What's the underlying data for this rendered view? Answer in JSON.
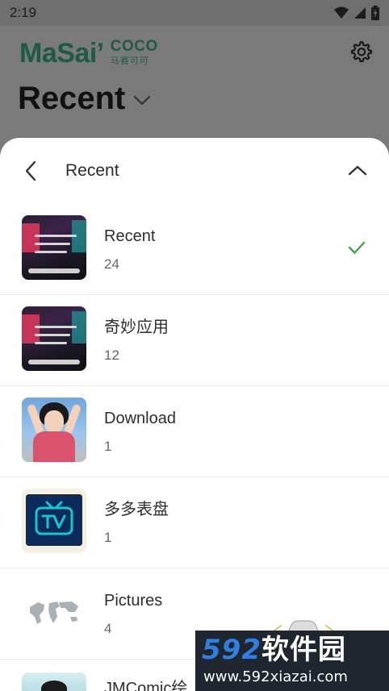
{
  "status_bar": {
    "time": "2:19",
    "icons": [
      "wifi-icon",
      "signal-icon",
      "battery-charging-icon"
    ]
  },
  "app": {
    "logo": {
      "main": "MaSai’",
      "side_top": "COCO",
      "side_bottom": "马赛可可"
    },
    "page_title": "Recent",
    "title_dropdown_icon": "chevron-down-icon",
    "settings_icon": "gear-icon"
  },
  "sheet": {
    "title": "Recent",
    "back_icon": "chevron-left-icon",
    "collapse_icon": "chevron-up-icon",
    "albums": [
      {
        "name": "Recent",
        "count": "24",
        "selected": true,
        "thumb": "app-screenshot"
      },
      {
        "name": "奇妙应用",
        "count": "12",
        "selected": false,
        "thumb": "app-screenshot"
      },
      {
        "name": "Download",
        "count": "1",
        "selected": false,
        "thumb": "girl-photo"
      },
      {
        "name": "多多表盘",
        "count": "1",
        "selected": false,
        "thumb": "tv-logo"
      },
      {
        "name": "Pictures",
        "count": "4",
        "selected": false,
        "thumb": "world-map"
      },
      {
        "name": "JMComic绘",
        "count": "",
        "selected": false,
        "thumb": "girl-photo"
      }
    ],
    "check_color": "#43a047"
  },
  "watermark": {
    "brand_num": "592",
    "brand_text": "软件园",
    "url": "www.592xiazai.com"
  }
}
